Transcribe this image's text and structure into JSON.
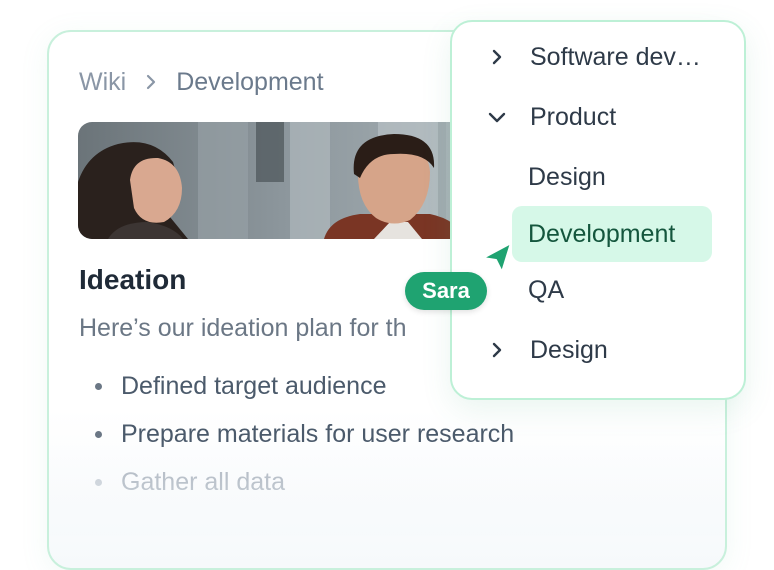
{
  "breadcrumb": {
    "root": "Wiki",
    "current": "Development"
  },
  "page": {
    "title": "Ideation",
    "subtitle": "Here’s our ideation plan for th",
    "bullets": [
      "Defined target audience",
      "Prepare materials for user research",
      "Gather all data"
    ]
  },
  "tree_menu": {
    "items": [
      {
        "label": "Software dev…",
        "state": "collapsed"
      },
      {
        "label": "Product",
        "state": "expanded"
      },
      {
        "label": "Design",
        "state": "leaf"
      },
      {
        "label": "Development",
        "state": "selected"
      },
      {
        "label": "QA",
        "state": "leaf"
      },
      {
        "label": "Design",
        "state": "collapsed"
      }
    ]
  },
  "collaborator": {
    "name": "Sara",
    "color": "#1fa371"
  },
  "colors": {
    "accent": "#1fa371",
    "selected_bg": "#d6f8e8",
    "border": "#c8f0dc"
  }
}
